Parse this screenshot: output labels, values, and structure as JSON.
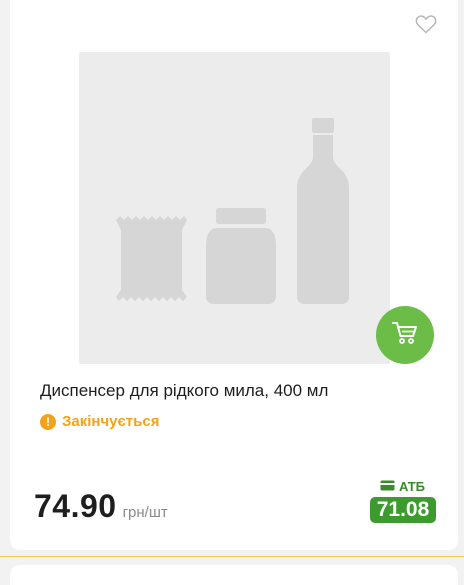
{
  "product": {
    "title": "Диспенсер для рідкого мила, 400 мл",
    "status": "Закінчується",
    "price": "74.90",
    "unit": "грн/шт",
    "atb_label": "АТБ",
    "atb_price": "71.08"
  },
  "icons": {
    "favorite": "heart-icon",
    "cart": "cart-icon",
    "status": "exclamation-icon",
    "card": "card-icon"
  },
  "colors": {
    "accent_green": "#6bbd47",
    "status_orange": "#f3a31a",
    "atb_green": "#3d9a2e",
    "separator_yellow": "#f3c94a"
  }
}
